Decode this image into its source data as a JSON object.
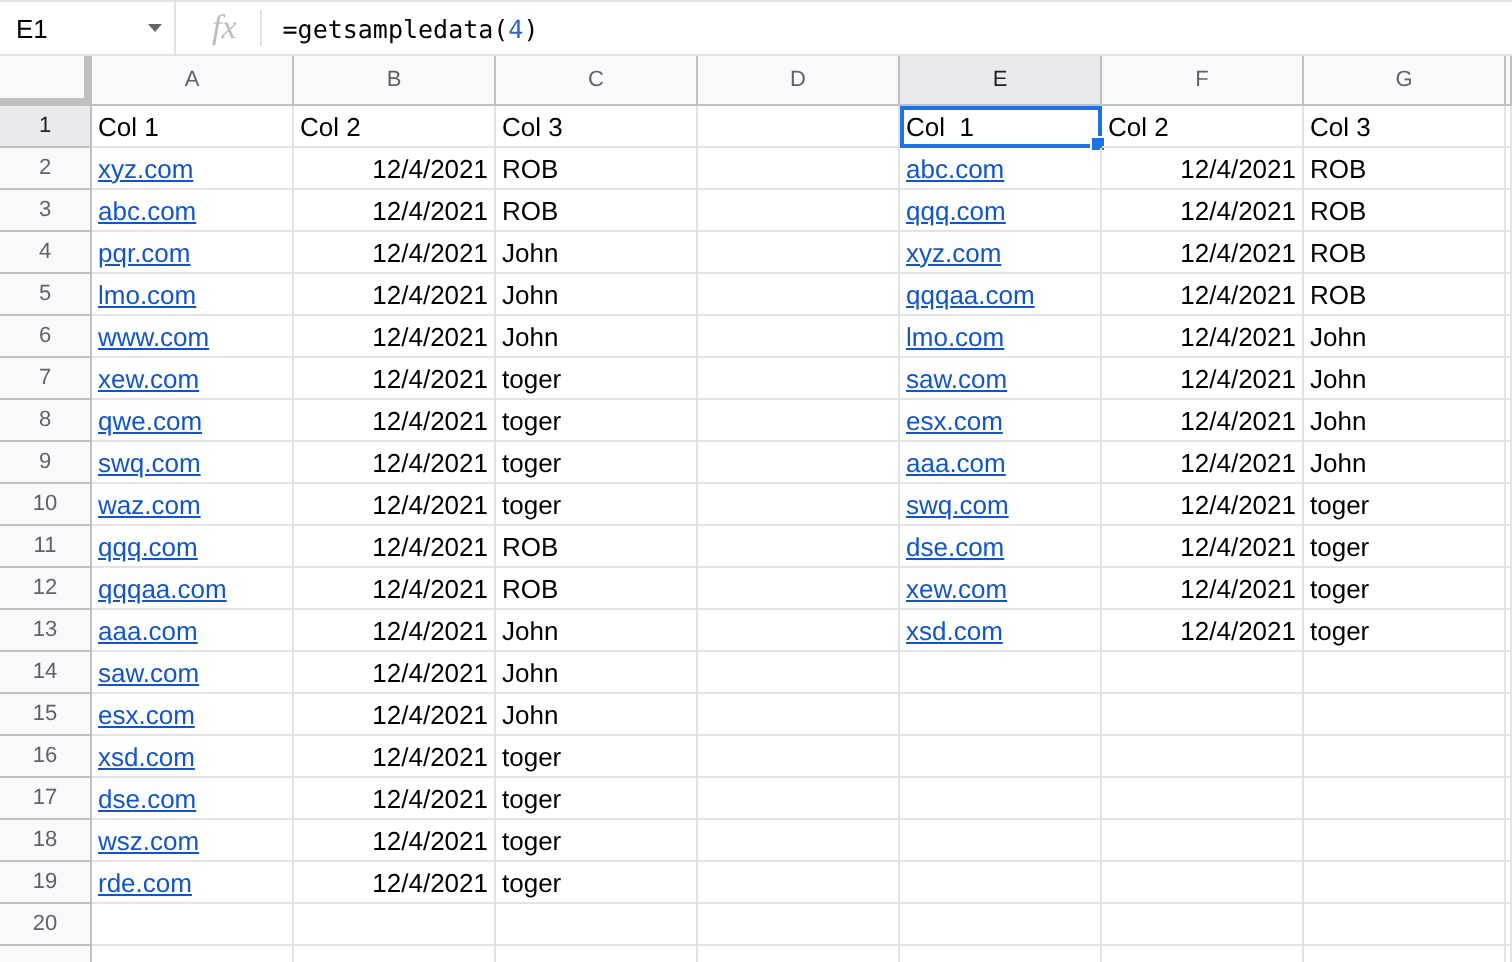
{
  "formula_bar": {
    "name_box": "E1",
    "function_icon": "fx",
    "formula": {
      "function": "=getsampledata(",
      "argument": "4",
      "close": ")"
    }
  },
  "columns": [
    {
      "label": "A",
      "selected": false
    },
    {
      "label": "B",
      "selected": false
    },
    {
      "label": "C",
      "selected": false
    },
    {
      "label": "D",
      "selected": false
    },
    {
      "label": "E",
      "selected": true
    },
    {
      "label": "F",
      "selected": false
    },
    {
      "label": "G",
      "selected": false
    }
  ],
  "rows": [
    {
      "number": "1",
      "selected": true,
      "cells": [
        {
          "text": "Col 1",
          "kind": "text",
          "selected": false
        },
        {
          "text": "Col 2",
          "kind": "text",
          "selected": false
        },
        {
          "text": "Col 3",
          "kind": "text",
          "selected": false
        },
        null,
        {
          "text": "Col  1",
          "kind": "text",
          "selected": true
        },
        {
          "text": "Col 2",
          "kind": "text",
          "selected": false
        },
        {
          "text": "Col 3",
          "kind": "text",
          "selected": false
        }
      ]
    },
    {
      "number": "2",
      "selected": false,
      "cells": [
        {
          "text": "xyz.com",
          "kind": "link"
        },
        {
          "text": "12/4/2021",
          "kind": "number"
        },
        {
          "text": "ROB",
          "kind": "text"
        },
        null,
        {
          "text": "abc.com",
          "kind": "link"
        },
        {
          "text": "12/4/2021",
          "kind": "number"
        },
        {
          "text": "ROB",
          "kind": "text"
        }
      ]
    },
    {
      "number": "3",
      "selected": false,
      "cells": [
        {
          "text": "abc.com",
          "kind": "link"
        },
        {
          "text": "12/4/2021",
          "kind": "number"
        },
        {
          "text": "ROB",
          "kind": "text"
        },
        null,
        {
          "text": "qqq.com",
          "kind": "link"
        },
        {
          "text": "12/4/2021",
          "kind": "number"
        },
        {
          "text": "ROB",
          "kind": "text"
        }
      ]
    },
    {
      "number": "4",
      "selected": false,
      "cells": [
        {
          "text": "pqr.com",
          "kind": "link"
        },
        {
          "text": "12/4/2021",
          "kind": "number"
        },
        {
          "text": "John",
          "kind": "text"
        },
        null,
        {
          "text": "xyz.com",
          "kind": "link"
        },
        {
          "text": "12/4/2021",
          "kind": "number"
        },
        {
          "text": "ROB",
          "kind": "text"
        }
      ]
    },
    {
      "number": "5",
      "selected": false,
      "cells": [
        {
          "text": "lmo.com",
          "kind": "link"
        },
        {
          "text": "12/4/2021",
          "kind": "number"
        },
        {
          "text": "John",
          "kind": "text"
        },
        null,
        {
          "text": "qqqaa.com",
          "kind": "link"
        },
        {
          "text": "12/4/2021",
          "kind": "number"
        },
        {
          "text": "ROB",
          "kind": "text"
        }
      ]
    },
    {
      "number": "6",
      "selected": false,
      "cells": [
        {
          "text": "www.com",
          "kind": "link"
        },
        {
          "text": "12/4/2021",
          "kind": "number"
        },
        {
          "text": "John",
          "kind": "text"
        },
        null,
        {
          "text": "lmo.com",
          "kind": "link"
        },
        {
          "text": "12/4/2021",
          "kind": "number"
        },
        {
          "text": "John",
          "kind": "text"
        }
      ]
    },
    {
      "number": "7",
      "selected": false,
      "cells": [
        {
          "text": "xew.com",
          "kind": "link"
        },
        {
          "text": "12/4/2021",
          "kind": "number"
        },
        {
          "text": "toger",
          "kind": "text"
        },
        null,
        {
          "text": "saw.com",
          "kind": "link"
        },
        {
          "text": "12/4/2021",
          "kind": "number"
        },
        {
          "text": "John",
          "kind": "text"
        }
      ]
    },
    {
      "number": "8",
      "selected": false,
      "cells": [
        {
          "text": "qwe.com",
          "kind": "link"
        },
        {
          "text": "12/4/2021",
          "kind": "number"
        },
        {
          "text": "toger",
          "kind": "text"
        },
        null,
        {
          "text": "esx.com",
          "kind": "link"
        },
        {
          "text": "12/4/2021",
          "kind": "number"
        },
        {
          "text": "John",
          "kind": "text"
        }
      ]
    },
    {
      "number": "9",
      "selected": false,
      "cells": [
        {
          "text": "swq.com",
          "kind": "link"
        },
        {
          "text": "12/4/2021",
          "kind": "number"
        },
        {
          "text": "toger",
          "kind": "text"
        },
        null,
        {
          "text": "aaa.com",
          "kind": "link"
        },
        {
          "text": "12/4/2021",
          "kind": "number"
        },
        {
          "text": "John",
          "kind": "text"
        }
      ]
    },
    {
      "number": "10",
      "selected": false,
      "cells": [
        {
          "text": "waz.com",
          "kind": "link"
        },
        {
          "text": "12/4/2021",
          "kind": "number"
        },
        {
          "text": "toger",
          "kind": "text"
        },
        null,
        {
          "text": "swq.com",
          "kind": "link"
        },
        {
          "text": "12/4/2021",
          "kind": "number"
        },
        {
          "text": "toger",
          "kind": "text"
        }
      ]
    },
    {
      "number": "11",
      "selected": false,
      "cells": [
        {
          "text": "qqq.com",
          "kind": "link"
        },
        {
          "text": "12/4/2021",
          "kind": "number"
        },
        {
          "text": "ROB",
          "kind": "text"
        },
        null,
        {
          "text": "dse.com",
          "kind": "link"
        },
        {
          "text": "12/4/2021",
          "kind": "number"
        },
        {
          "text": "toger",
          "kind": "text"
        }
      ]
    },
    {
      "number": "12",
      "selected": false,
      "cells": [
        {
          "text": "qqqaa.com",
          "kind": "link"
        },
        {
          "text": "12/4/2021",
          "kind": "number"
        },
        {
          "text": "ROB",
          "kind": "text"
        },
        null,
        {
          "text": "xew.com",
          "kind": "link"
        },
        {
          "text": "12/4/2021",
          "kind": "number"
        },
        {
          "text": "toger",
          "kind": "text"
        }
      ]
    },
    {
      "number": "13",
      "selected": false,
      "cells": [
        {
          "text": "aaa.com",
          "kind": "link"
        },
        {
          "text": "12/4/2021",
          "kind": "number"
        },
        {
          "text": "John",
          "kind": "text"
        },
        null,
        {
          "text": "xsd.com",
          "kind": "link"
        },
        {
          "text": "12/4/2021",
          "kind": "number"
        },
        {
          "text": "toger",
          "kind": "text"
        }
      ]
    },
    {
      "number": "14",
      "selected": false,
      "cells": [
        {
          "text": "saw.com",
          "kind": "link"
        },
        {
          "text": "12/4/2021",
          "kind": "number"
        },
        {
          "text": "John",
          "kind": "text"
        },
        null,
        null,
        null,
        null
      ]
    },
    {
      "number": "15",
      "selected": false,
      "cells": [
        {
          "text": "esx.com",
          "kind": "link"
        },
        {
          "text": "12/4/2021",
          "kind": "number"
        },
        {
          "text": "John",
          "kind": "text"
        },
        null,
        null,
        null,
        null
      ]
    },
    {
      "number": "16",
      "selected": false,
      "cells": [
        {
          "text": "xsd.com",
          "kind": "link"
        },
        {
          "text": "12/4/2021",
          "kind": "number"
        },
        {
          "text": "toger",
          "kind": "text"
        },
        null,
        null,
        null,
        null
      ]
    },
    {
      "number": "17",
      "selected": false,
      "cells": [
        {
          "text": "dse.com",
          "kind": "link"
        },
        {
          "text": "12/4/2021",
          "kind": "number"
        },
        {
          "text": "toger",
          "kind": "text"
        },
        null,
        null,
        null,
        null
      ]
    },
    {
      "number": "18",
      "selected": false,
      "cells": [
        {
          "text": "wsz.com",
          "kind": "link"
        },
        {
          "text": "12/4/2021",
          "kind": "number"
        },
        {
          "text": "toger",
          "kind": "text"
        },
        null,
        null,
        null,
        null
      ]
    },
    {
      "number": "19",
      "selected": false,
      "cells": [
        {
          "text": "rde.com",
          "kind": "link"
        },
        {
          "text": "12/4/2021",
          "kind": "number"
        },
        {
          "text": "toger",
          "kind": "text"
        },
        null,
        null,
        null,
        null
      ]
    },
    {
      "number": "20",
      "selected": false,
      "cells": [
        null,
        null,
        null,
        null,
        null,
        null,
        null
      ]
    }
  ]
}
